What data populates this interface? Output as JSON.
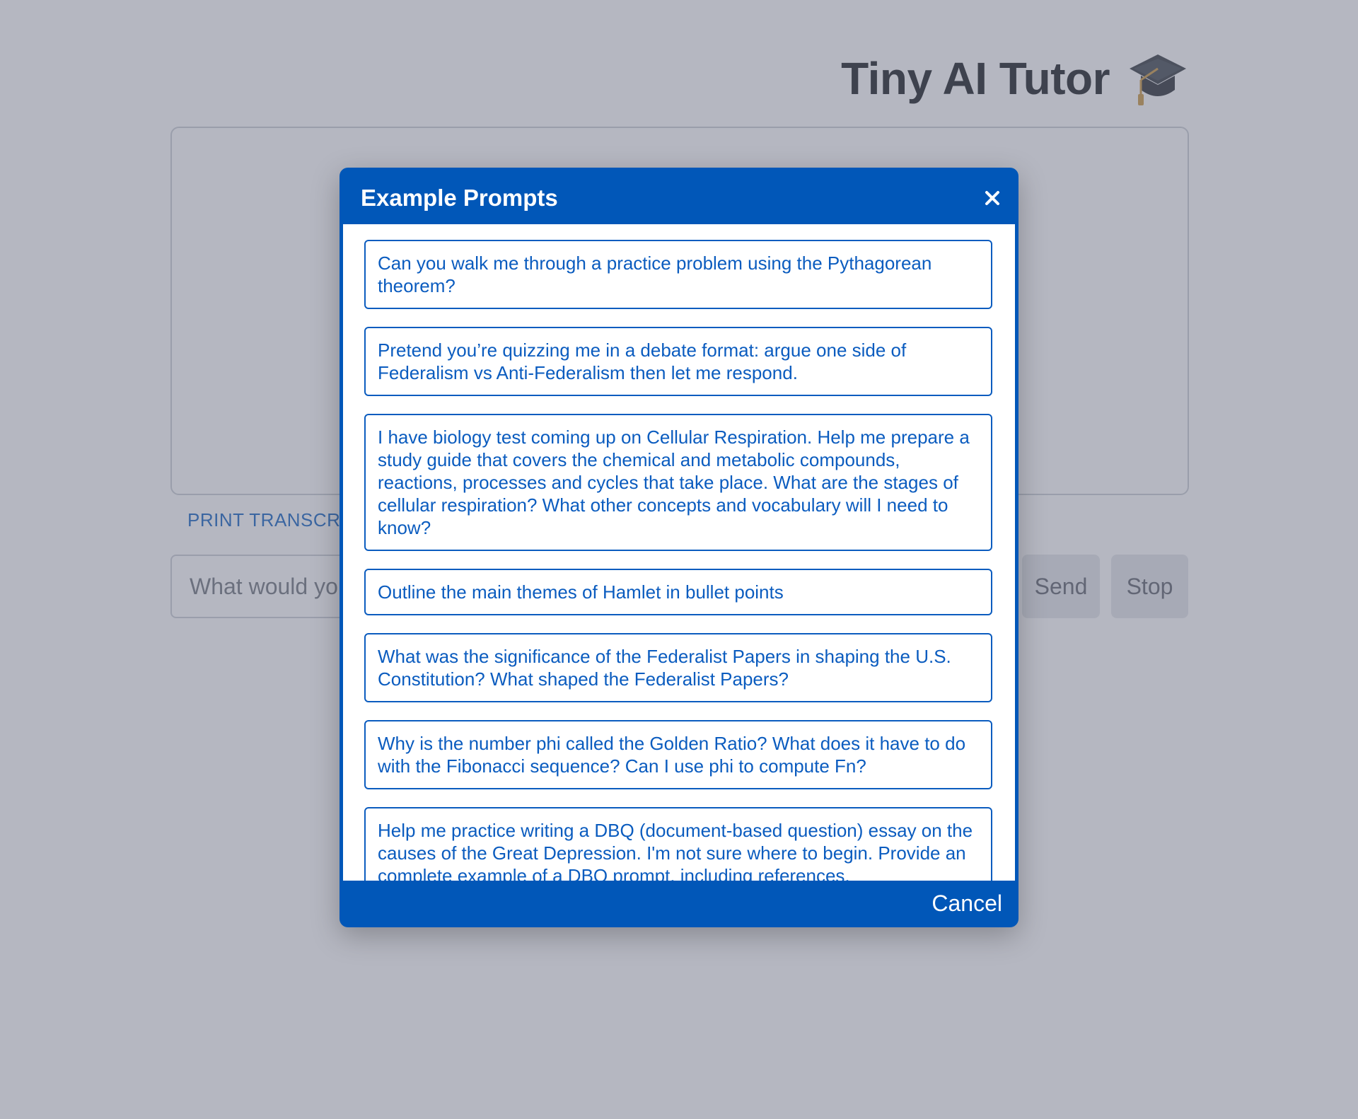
{
  "app": {
    "title": "Tiny AI Tutor",
    "title_icon": "graduation-cap-icon"
  },
  "toolbar": {
    "print_transcript_label": "PRINT TRANSCRIPT",
    "input_placeholder": "What would you like to learn about?",
    "send_label": "Send",
    "stop_label": "Stop"
  },
  "modal": {
    "title": "Example Prompts",
    "close_icon": "close-icon",
    "prompts": [
      "Can you walk me through a practice problem using the Pythagorean theorem?",
      "Pretend you’re quizzing me in a debate format: argue one side of Federalism vs Anti-Federalism then let me respond.",
      "I have biology test coming up on Cellular Respiration. Help me prepare a study guide that covers the chemical and metabolic compounds, reactions, processes and cycles that take place. What are the stages of cellular respiration? What other concepts and vocabulary will I need to know?",
      "Outline the main themes of Hamlet in bullet points",
      "What was the significance of the Federalist Papers in shaping the U.S. Constitution? What shaped the Federalist Papers?",
      "Why is the number phi called the Golden Ratio? What does it have to do with the Fibonacci sequence? Can I use phi to compute Fn?",
      "Help me practice writing a DBQ (document-based question) essay on the causes of the Great Depression. I'm not sure where to begin. Provide an complete example of a DBQ prompt, including references."
    ],
    "cancel_label": "Cancel"
  },
  "colors": {
    "accent": "#0157b8",
    "link": "#0b5cbf",
    "backdrop": "#b5b6c1"
  }
}
